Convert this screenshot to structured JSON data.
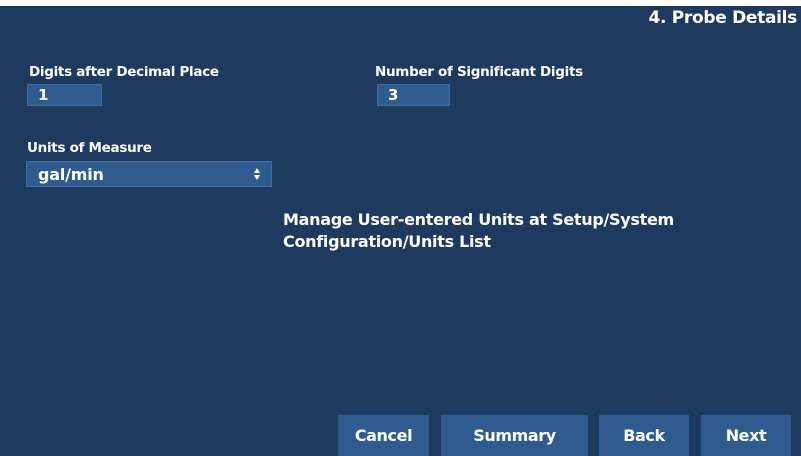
{
  "header": {
    "step_title": "4. Probe Details"
  },
  "fields": {
    "decimal_places": {
      "label": "Digits after Decimal Place",
      "value": "1"
    },
    "significant_digits": {
      "label": "Number of Significant Digits",
      "value": "3"
    },
    "units": {
      "label": "Units of Measure",
      "selected": "gal/min"
    }
  },
  "info": {
    "text": "Manage User-entered Units at Setup/System Configuration/Units List"
  },
  "buttons": {
    "cancel": "Cancel",
    "summary": "Summary",
    "back": "Back",
    "next": "Next"
  },
  "colors": {
    "background": "#1f3a5f",
    "field": "#2f5b8f",
    "text": "#ffffff"
  },
  "icons": {
    "select_arrows": "updown-stepper-icon"
  }
}
